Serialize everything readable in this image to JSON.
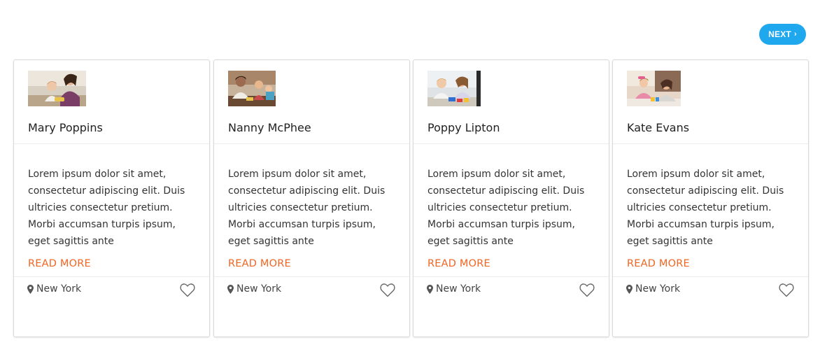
{
  "pager": {
    "next_label": "NEXT",
    "next_icon": "chevron-right-icon",
    "next_color": "#1fa8ee"
  },
  "colors": {
    "accent": "#f26522",
    "next_button": "#1fa8ee"
  },
  "cards": [
    {
      "name": "Mary Poppins",
      "description": "Lorem ipsum dolor sit amet, consectetur adipiscing elit. Duis ultricies consectetur pretium. Morbi accumsan turpis ipsum, eget sagittis ante",
      "read_more": "READ MORE",
      "location": "New York",
      "location_icon": "map-pin-icon",
      "favorite_icon": "heart-outline-icon"
    },
    {
      "name": "Nanny McPhee",
      "description": "Lorem ipsum dolor sit amet, consectetur adipiscing elit. Duis ultricies consectetur pretium. Morbi accumsan turpis ipsum, eget sagittis ante",
      "read_more": "READ MORE",
      "location": "New York",
      "location_icon": "map-pin-icon",
      "favorite_icon": "heart-outline-icon"
    },
    {
      "name": "Poppy Lipton",
      "description": "Lorem ipsum dolor sit amet, consectetur adipiscing elit. Duis ultricies consectetur pretium. Morbi accumsan turpis ipsum, eget sagittis ante",
      "read_more": "READ MORE",
      "location": "New York",
      "location_icon": "map-pin-icon",
      "favorite_icon": "heart-outline-icon"
    },
    {
      "name": "Kate Evans",
      "description": "Lorem ipsum dolor sit amet, consectetur adipiscing elit. Duis ultricies consectetur pretium. Morbi accumsan turpis ipsum, eget sagittis ante",
      "read_more": "READ MORE",
      "location": "New York",
      "location_icon": "map-pin-icon",
      "favorite_icon": "heart-outline-icon"
    }
  ]
}
